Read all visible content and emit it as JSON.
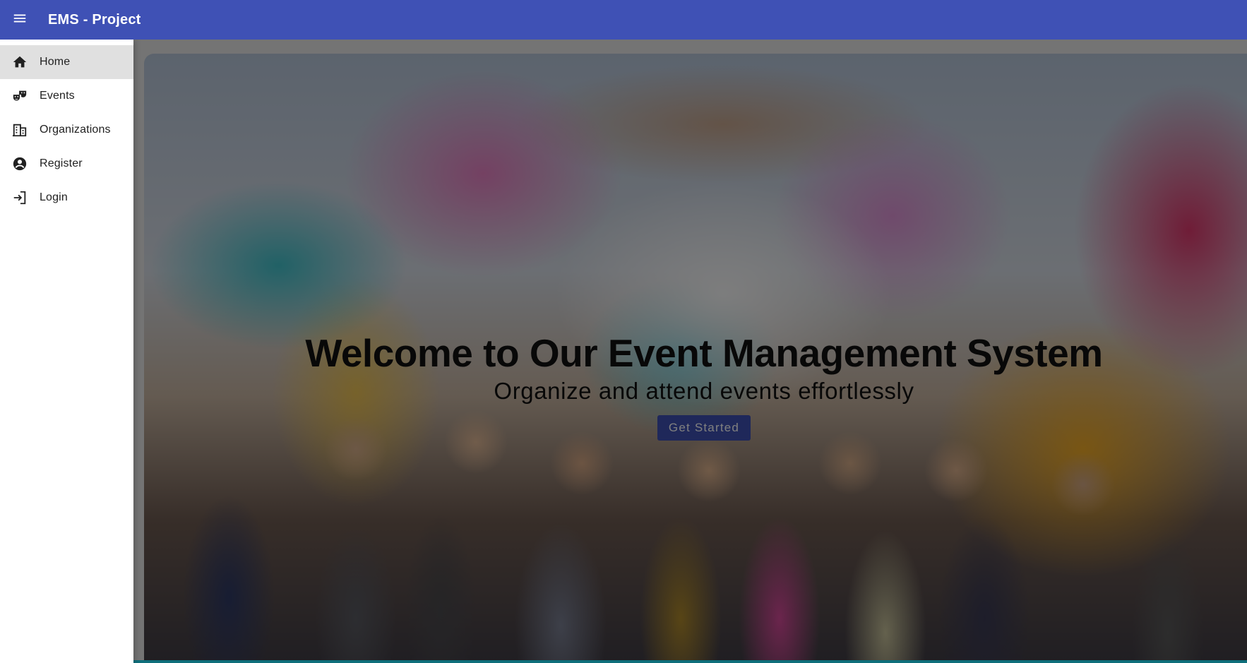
{
  "app": {
    "title": "EMS - Project",
    "brand_color": "#3f51b5"
  },
  "toolbar": {
    "menu_icon": "menu-icon"
  },
  "sidebar": {
    "items": [
      {
        "label": "Home",
        "icon": "home-icon",
        "active": true
      },
      {
        "label": "Events",
        "icon": "theater-masks-icon",
        "active": false
      },
      {
        "label": "Organizations",
        "icon": "building-icon",
        "active": false
      },
      {
        "label": "Register",
        "icon": "account-circle-icon",
        "active": false
      },
      {
        "label": "Login",
        "icon": "login-icon",
        "active": false
      }
    ]
  },
  "hero": {
    "title": "Welcome to Our Event Management System",
    "subtitle": "Organize and attend events effortlessly",
    "cta_label": "Get Started"
  }
}
